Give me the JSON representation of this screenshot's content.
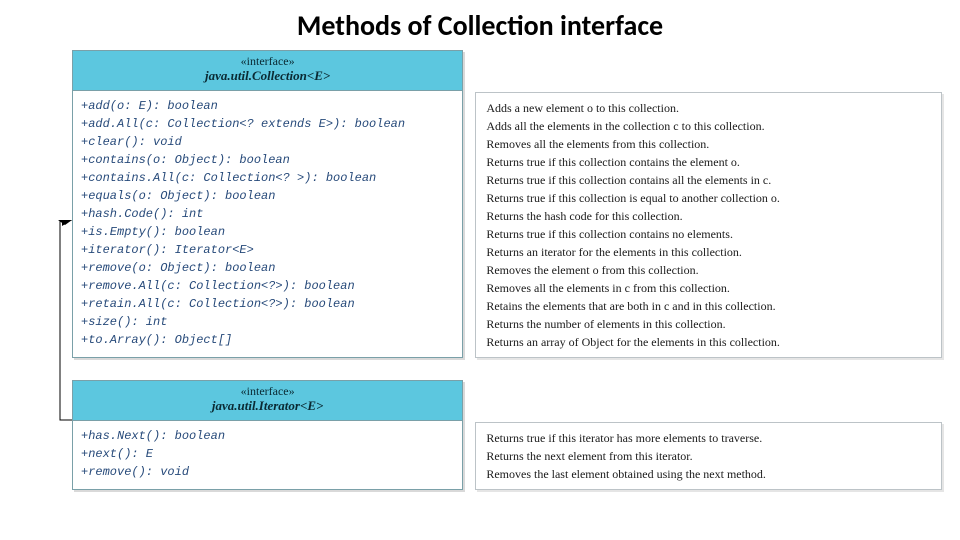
{
  "title": "Methods of Collection interface",
  "collection": {
    "stereotype": "«interface»",
    "name": "java.util.Collection<E>",
    "methods": [
      "+add(o: E): boolean",
      "+add.All(c: Collection<? extends E>): boolean",
      "+clear(): void",
      "+contains(o: Object): boolean",
      "+contains.All(c: Collection<? >): boolean",
      "+equals(o: Object): boolean",
      "+hash.Code(): int",
      "+is.Empty(): boolean",
      "+iterator(): Iterator<E>",
      "+remove(o: Object): boolean",
      "+remove.All(c: Collection<?>): boolean",
      "+retain.All(c: Collection<?>): boolean",
      "+size(): int",
      "+to.Array(): Object[]"
    ],
    "descriptions": [
      "Adds a new element o to this collection.",
      "Adds all the elements in the collection c to this collection.",
      "Removes all the elements from this collection.",
      "Returns true if this collection contains the element o.",
      "Returns true if this collection contains all the elements in c.",
      "Returns true if this collection is equal to another collection o.",
      "Returns the hash code for this collection.",
      "Returns true if this collection contains no elements.",
      "Returns an iterator for the elements in this collection.",
      "Removes the element o from this collection.",
      "Removes all the elements in c from this collection.",
      "Retains the elements that are both in c and in this collection.",
      "Returns the number of elements in this collection.",
      "Returns an array of Object for the elements in this collection."
    ]
  },
  "iterator": {
    "stereotype": "«interface»",
    "name": "java.util.Iterator<E>",
    "methods": [
      "+has.Next(): boolean",
      "+next(): E",
      "+remove(): void"
    ],
    "descriptions": [
      "Returns true if this iterator has more elements to traverse.",
      "Returns the next element from this iterator.",
      "Removes the last element obtained using the next method."
    ]
  }
}
